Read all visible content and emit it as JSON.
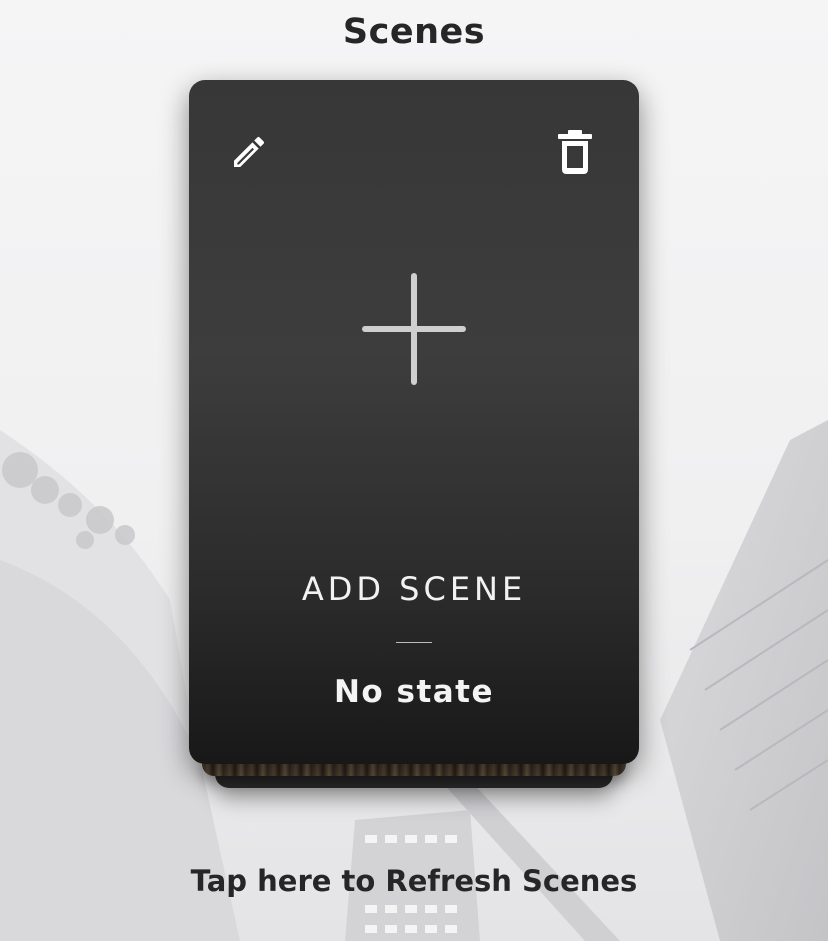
{
  "header": {
    "title": "Scenes"
  },
  "scene_card": {
    "name": "ADD SCENE",
    "state": "No state",
    "edit_icon": "pencil-icon",
    "delete_icon": "trash-icon",
    "add_icon": "plus-icon"
  },
  "footer": {
    "refresh_label": "Tap here to Refresh Scenes"
  },
  "colors": {
    "card_top": "#373737",
    "card_bottom": "#181818",
    "text_dark": "#262626",
    "text_light": "#f2f2f2"
  }
}
